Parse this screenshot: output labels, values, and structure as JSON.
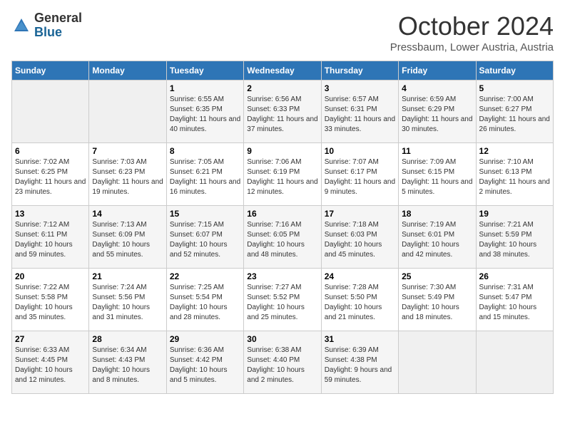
{
  "header": {
    "logo": {
      "general": "General",
      "blue": "Blue"
    },
    "title": "October 2024",
    "location": "Pressbaum, Lower Austria, Austria"
  },
  "calendar": {
    "weekdays": [
      "Sunday",
      "Monday",
      "Tuesday",
      "Wednesday",
      "Thursday",
      "Friday",
      "Saturday"
    ],
    "weeks": [
      [
        {
          "day": null
        },
        {
          "day": null
        },
        {
          "day": "1",
          "sunrise": "6:55 AM",
          "sunset": "6:35 PM",
          "daylight": "11 hours and 40 minutes."
        },
        {
          "day": "2",
          "sunrise": "6:56 AM",
          "sunset": "6:33 PM",
          "daylight": "11 hours and 37 minutes."
        },
        {
          "day": "3",
          "sunrise": "6:57 AM",
          "sunset": "6:31 PM",
          "daylight": "11 hours and 33 minutes."
        },
        {
          "day": "4",
          "sunrise": "6:59 AM",
          "sunset": "6:29 PM",
          "daylight": "11 hours and 30 minutes."
        },
        {
          "day": "5",
          "sunrise": "7:00 AM",
          "sunset": "6:27 PM",
          "daylight": "11 hours and 26 minutes."
        }
      ],
      [
        {
          "day": "6",
          "sunrise": "7:02 AM",
          "sunset": "6:25 PM",
          "daylight": "11 hours and 23 minutes."
        },
        {
          "day": "7",
          "sunrise": "7:03 AM",
          "sunset": "6:23 PM",
          "daylight": "11 hours and 19 minutes."
        },
        {
          "day": "8",
          "sunrise": "7:05 AM",
          "sunset": "6:21 PM",
          "daylight": "11 hours and 16 minutes."
        },
        {
          "day": "9",
          "sunrise": "7:06 AM",
          "sunset": "6:19 PM",
          "daylight": "11 hours and 12 minutes."
        },
        {
          "day": "10",
          "sunrise": "7:07 AM",
          "sunset": "6:17 PM",
          "daylight": "11 hours and 9 minutes."
        },
        {
          "day": "11",
          "sunrise": "7:09 AM",
          "sunset": "6:15 PM",
          "daylight": "11 hours and 5 minutes."
        },
        {
          "day": "12",
          "sunrise": "7:10 AM",
          "sunset": "6:13 PM",
          "daylight": "11 hours and 2 minutes."
        }
      ],
      [
        {
          "day": "13",
          "sunrise": "7:12 AM",
          "sunset": "6:11 PM",
          "daylight": "10 hours and 59 minutes."
        },
        {
          "day": "14",
          "sunrise": "7:13 AM",
          "sunset": "6:09 PM",
          "daylight": "10 hours and 55 minutes."
        },
        {
          "day": "15",
          "sunrise": "7:15 AM",
          "sunset": "6:07 PM",
          "daylight": "10 hours and 52 minutes."
        },
        {
          "day": "16",
          "sunrise": "7:16 AM",
          "sunset": "6:05 PM",
          "daylight": "10 hours and 48 minutes."
        },
        {
          "day": "17",
          "sunrise": "7:18 AM",
          "sunset": "6:03 PM",
          "daylight": "10 hours and 45 minutes."
        },
        {
          "day": "18",
          "sunrise": "7:19 AM",
          "sunset": "6:01 PM",
          "daylight": "10 hours and 42 minutes."
        },
        {
          "day": "19",
          "sunrise": "7:21 AM",
          "sunset": "5:59 PM",
          "daylight": "10 hours and 38 minutes."
        }
      ],
      [
        {
          "day": "20",
          "sunrise": "7:22 AM",
          "sunset": "5:58 PM",
          "daylight": "10 hours and 35 minutes."
        },
        {
          "day": "21",
          "sunrise": "7:24 AM",
          "sunset": "5:56 PM",
          "daylight": "10 hours and 31 minutes."
        },
        {
          "day": "22",
          "sunrise": "7:25 AM",
          "sunset": "5:54 PM",
          "daylight": "10 hours and 28 minutes."
        },
        {
          "day": "23",
          "sunrise": "7:27 AM",
          "sunset": "5:52 PM",
          "daylight": "10 hours and 25 minutes."
        },
        {
          "day": "24",
          "sunrise": "7:28 AM",
          "sunset": "5:50 PM",
          "daylight": "10 hours and 21 minutes."
        },
        {
          "day": "25",
          "sunrise": "7:30 AM",
          "sunset": "5:49 PM",
          "daylight": "10 hours and 18 minutes."
        },
        {
          "day": "26",
          "sunrise": "7:31 AM",
          "sunset": "5:47 PM",
          "daylight": "10 hours and 15 minutes."
        }
      ],
      [
        {
          "day": "27",
          "sunrise": "6:33 AM",
          "sunset": "4:45 PM",
          "daylight": "10 hours and 12 minutes."
        },
        {
          "day": "28",
          "sunrise": "6:34 AM",
          "sunset": "4:43 PM",
          "daylight": "10 hours and 8 minutes."
        },
        {
          "day": "29",
          "sunrise": "6:36 AM",
          "sunset": "4:42 PM",
          "daylight": "10 hours and 5 minutes."
        },
        {
          "day": "30",
          "sunrise": "6:38 AM",
          "sunset": "4:40 PM",
          "daylight": "10 hours and 2 minutes."
        },
        {
          "day": "31",
          "sunrise": "6:39 AM",
          "sunset": "4:38 PM",
          "daylight": "9 hours and 59 minutes."
        },
        {
          "day": null
        },
        {
          "day": null
        }
      ]
    ]
  }
}
